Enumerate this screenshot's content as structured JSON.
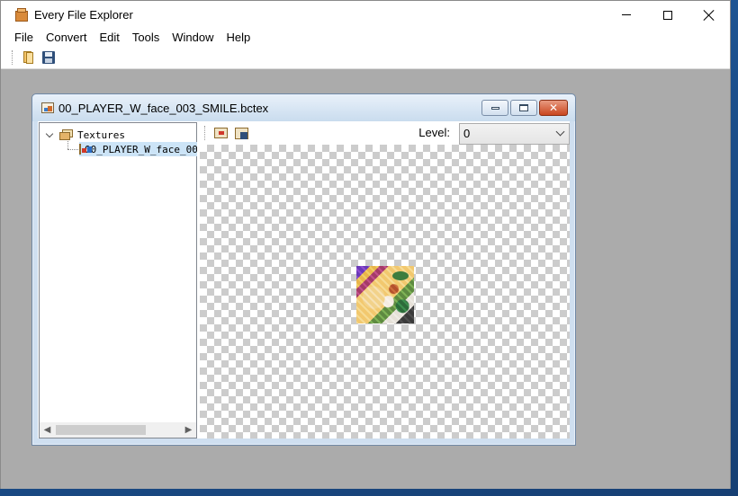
{
  "app": {
    "title": "Every File Explorer"
  },
  "menu": {
    "items": [
      "File",
      "Convert",
      "Edit",
      "Tools",
      "Window",
      "Help"
    ]
  },
  "toolbar": {
    "buttons": [
      {
        "icon": "open-icon"
      },
      {
        "icon": "save-icon"
      }
    ]
  },
  "child_window": {
    "title": "00_PLAYER_W_face_003_SMILE.bctex",
    "tree": {
      "root_label": "Textures",
      "child_label": "00_PLAYER_W_face_00"
    },
    "viewer": {
      "level_label": "Level:",
      "level_value": "0",
      "toolbar_icons": [
        "export-icon",
        "import-icon"
      ]
    }
  },
  "colors": {
    "mdi_background": "#ababab",
    "selection": "#cce4f7",
    "close_button": "#c9461f"
  }
}
